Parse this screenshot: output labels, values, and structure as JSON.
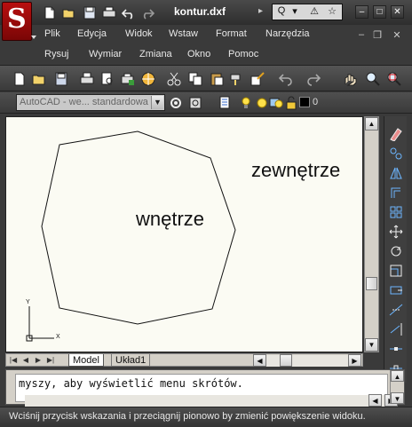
{
  "titlebar": {
    "document_title": "kontur.dxf",
    "search_segments": [
      "Q",
      "▾",
      "⚠",
      "☆"
    ]
  },
  "menus": {
    "row1": [
      "Plik",
      "Edycja",
      "Widok",
      "Wstaw",
      "Format",
      "Narzędzia"
    ],
    "row2": [
      "Rysuj",
      "Wymiar",
      "Zmiana",
      "Okno",
      "Pomoc"
    ]
  },
  "window_controls": {
    "minimize": "–",
    "restore": "□",
    "close": "✕"
  },
  "mdi_controls": {
    "minimize": "–",
    "restore": "❐",
    "close": "✕"
  },
  "toolbar2": {
    "workspace_value": "AutoCAD - we... standardowa",
    "layer_value": "0"
  },
  "canvas": {
    "label_outer": "zewnętrze",
    "label_inner": "wnętrze",
    "ucs_x": "X",
    "ucs_y": "Y"
  },
  "tabs": {
    "model": "Model",
    "layout1": "Układ1"
  },
  "command_line": {
    "text": "myszy, aby wyświetlić menu skrótów."
  },
  "statusbar": {
    "text": "Wciśnij przycisk wskazania i przeciągnij pionowo by zmienić powiększenie widoku."
  },
  "colors": {
    "canvas_bg": "#fbfbf3",
    "chrome_dark": "#3a3a3a",
    "logo_red": "#b80f0f"
  }
}
